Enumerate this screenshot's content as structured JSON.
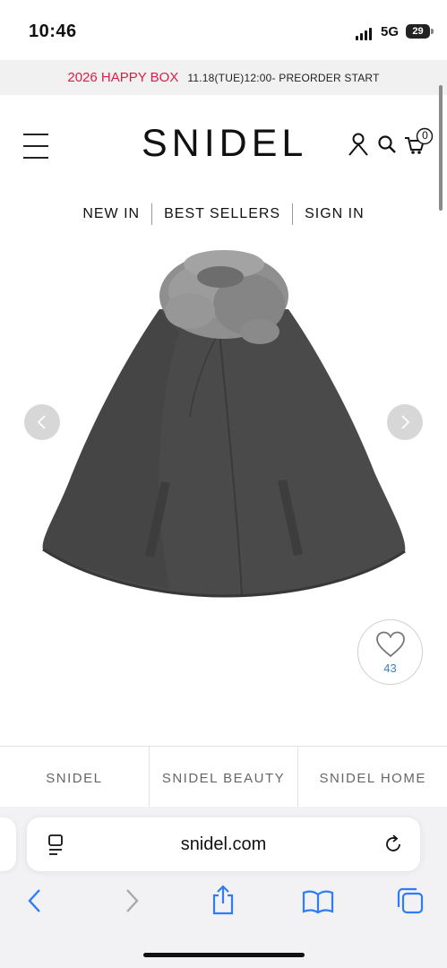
{
  "status_bar": {
    "time": "10:46",
    "network": "5G",
    "battery": "29",
    "icons": [
      "signal-icon",
      "battery-icon"
    ]
  },
  "announcement": {
    "highlight": "2026 HAPPY BOX",
    "detail": "11.18(TUE)12:00- PREORDER START",
    "highlight_color": "#d8204a"
  },
  "header": {
    "logo": "SNIDEL",
    "cart_count": "0",
    "icons": [
      "menu-icon",
      "account-icon",
      "search-icon",
      "cart-icon"
    ]
  },
  "nav": {
    "items": [
      "NEW IN",
      "BEST SELLERS",
      "SIGN IN"
    ]
  },
  "product": {
    "image_description_icon": "grey-cape-with-fur-collar",
    "like_count": "43",
    "like_icon": "heart-icon",
    "carousel_icons": [
      "chevron-left-icon",
      "chevron-right-icon"
    ]
  },
  "brand_tabs": [
    "SNIDEL",
    "SNIDEL BEAUTY",
    "SNIDEL HOME"
  ],
  "browser": {
    "url": "snidel.com",
    "icons": [
      "page-menu-icon",
      "reload-icon",
      "back-icon",
      "forward-icon",
      "share-icon",
      "bookmarks-icon",
      "tabs-icon"
    ]
  }
}
